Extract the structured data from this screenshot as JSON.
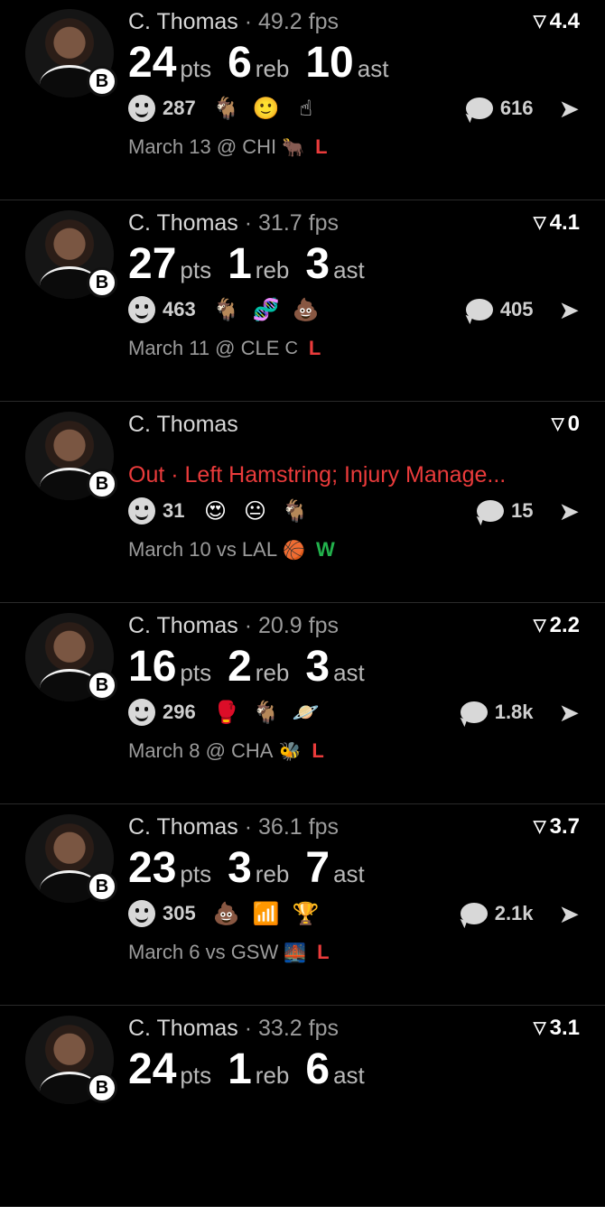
{
  "feed": [
    {
      "name": "C. Thomas",
      "fps": "49.2 fps",
      "score": "4.4",
      "stats": [
        {
          "value": "24",
          "unit": "pts"
        },
        {
          "value": "6",
          "unit": "reb"
        },
        {
          "value": "10",
          "unit": "ast"
        }
      ],
      "injury": "",
      "reactions": "287",
      "emojis": [
        "🐐",
        "🙂",
        "☝"
      ],
      "comments": "616",
      "game": "March 13 @ CHI",
      "team_icon": "🐂",
      "result": "L",
      "result_color": "#ea3b3b"
    },
    {
      "name": "C. Thomas",
      "fps": "31.7 fps",
      "score": "4.1",
      "stats": [
        {
          "value": "27",
          "unit": "pts"
        },
        {
          "value": "1",
          "unit": "reb"
        },
        {
          "value": "3",
          "unit": "ast"
        }
      ],
      "injury": "",
      "reactions": "463",
      "emojis": [
        "🐐",
        "🧬",
        "💩"
      ],
      "comments": "405",
      "game": "March 11 @ CLE",
      "team_icon": "C",
      "result": "L",
      "result_color": "#ea3b3b"
    },
    {
      "name": "C. Thomas",
      "fps": "",
      "score": "0",
      "stats": [],
      "injury": "Out · Left Hamstring; Injury Manage...",
      "reactions": "31",
      "emojis": [
        "😍",
        "😐",
        "🐐"
      ],
      "comments": "15",
      "game": "March 10 vs LAL",
      "team_icon": "🏀",
      "result": "W",
      "result_color": "#22b14c"
    },
    {
      "name": "C. Thomas",
      "fps": "20.9 fps",
      "score": "2.2",
      "stats": [
        {
          "value": "16",
          "unit": "pts"
        },
        {
          "value": "2",
          "unit": "reb"
        },
        {
          "value": "3",
          "unit": "ast"
        }
      ],
      "injury": "",
      "reactions": "296",
      "emojis": [
        "🥊",
        "🐐",
        "🪐"
      ],
      "comments": "1.8k",
      "game": "March 8 @ CHA",
      "team_icon": "🐝",
      "result": "L",
      "result_color": "#ea3b3b"
    },
    {
      "name": "C. Thomas",
      "fps": "36.1 fps",
      "score": "3.7",
      "stats": [
        {
          "value": "23",
          "unit": "pts"
        },
        {
          "value": "3",
          "unit": "reb"
        },
        {
          "value": "7",
          "unit": "ast"
        }
      ],
      "injury": "",
      "reactions": "305",
      "emojis": [
        "💩",
        "📶",
        "🏆"
      ],
      "comments": "2.1k",
      "game": "March 6 vs GSW",
      "team_icon": "🌉",
      "result": "L",
      "result_color": "#ea3b3b"
    },
    {
      "name": "C. Thomas",
      "fps": "33.2 fps",
      "score": "3.1",
      "stats": [
        {
          "value": "24",
          "unit": "pts"
        },
        {
          "value": "1",
          "unit": "reb"
        },
        {
          "value": "6",
          "unit": "ast"
        }
      ],
      "injury": "",
      "reactions": "",
      "emojis": [],
      "comments": "",
      "game": "",
      "team_icon": "",
      "result": "",
      "result_color": "#ea3b3b"
    }
  ]
}
